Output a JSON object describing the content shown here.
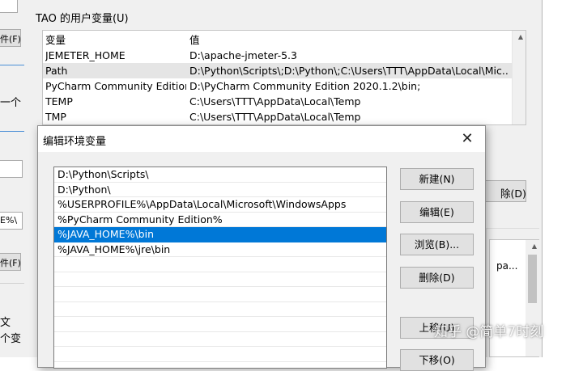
{
  "background_window": {
    "strip_texts": [
      "件(F)..",
      "一个",
      "E%\\",
      "件(F)..",
      "文",
      "个变"
    ]
  },
  "env_window": {
    "user_vars_title": "TAO 的用户变量(U)",
    "columns": {
      "name": "变量",
      "value": "值"
    },
    "rows": [
      {
        "name": "JEMETER_HOME",
        "value": "D:\\apache-jmeter-5.3"
      },
      {
        "name": "Path",
        "value": "D:\\Python\\Scripts\\;D:\\Python\\;C:\\Users\\TTT\\AppData\\Local\\Mic..."
      },
      {
        "name": "PyCharm Community Edition",
        "value": "D:\\PyCharm Community Edition 2020.1.2\\bin;"
      },
      {
        "name": "TEMP",
        "value": "C:\\Users\\TTT\\AppData\\Local\\Temp"
      },
      {
        "name": "TMP",
        "value": "C:\\Users\\TTT\\AppData\\Local\\Temp"
      }
    ],
    "selected_row": "Path",
    "delete_button_partial": "除(D)",
    "system_list_partial_text": "pa..."
  },
  "edit_dialog": {
    "title": "编辑环境变量",
    "close_glyph": "✕",
    "entries": [
      "D:\\Python\\Scripts\\",
      "D:\\Python\\",
      "%USERPROFILE%\\AppData\\Local\\Microsoft\\WindowsApps",
      "%PyCharm Community Edition%",
      "%JAVA_HOME%\\bin",
      "%JAVA_HOME%\\jre\\bin"
    ],
    "selected_entry": "%JAVA_HOME%\\bin",
    "buttons": {
      "new": "新建(N)",
      "edit": "编辑(E)",
      "browse": "浏览(B)...",
      "delete": "删除(D)",
      "move_up": "上移(U)",
      "move_down": "下移(O)"
    }
  },
  "watermark": "知乎 @简单7时刻",
  "colors": {
    "selection_blue": "#0078d7",
    "window_bg": "#f0f0f0",
    "row_selected_gray": "#e5e5e5"
  }
}
